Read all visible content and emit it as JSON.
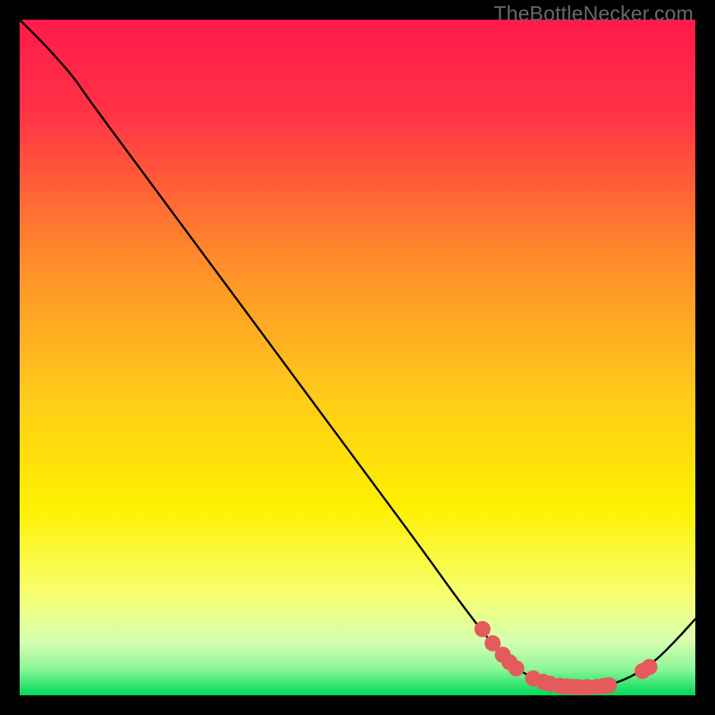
{
  "watermark": "TheBottleNecker.com",
  "chart_data": {
    "type": "line",
    "title": "",
    "xlabel": "",
    "ylabel": "",
    "xlim": [
      0,
      100
    ],
    "ylim": [
      0,
      100
    ],
    "grid": false,
    "legend": false,
    "background_gradient_top": "#ff1a4a",
    "background_gradient_mid_upper": "#ffb300",
    "background_gradient_mid_lower": "#fff700",
    "background_gradient_bottom": "#00e05a",
    "curve": [
      {
        "x": 0,
        "y": 100
      },
      {
        "x": 4,
        "y": 96
      },
      {
        "x": 8,
        "y": 91.5
      },
      {
        "x": 10,
        "y": 88.5
      },
      {
        "x": 20,
        "y": 75
      },
      {
        "x": 30,
        "y": 61.5
      },
      {
        "x": 40,
        "y": 48
      },
      {
        "x": 50,
        "y": 34.5
      },
      {
        "x": 60,
        "y": 21
      },
      {
        "x": 65,
        "y": 14
      },
      {
        "x": 70,
        "y": 7.5
      },
      {
        "x": 73,
        "y": 4.3
      },
      {
        "x": 76,
        "y": 2.5
      },
      {
        "x": 79,
        "y": 1.5
      },
      {
        "x": 82,
        "y": 1.2
      },
      {
        "x": 85,
        "y": 1.2
      },
      {
        "x": 88,
        "y": 1.7
      },
      {
        "x": 91,
        "y": 3.0
      },
      {
        "x": 94,
        "y": 5.0
      },
      {
        "x": 97,
        "y": 8.0
      },
      {
        "x": 100,
        "y": 11.3
      }
    ],
    "markers": [
      {
        "x": 68.5,
        "y": 9.8
      },
      {
        "x": 70.0,
        "y": 7.7
      },
      {
        "x": 71.5,
        "y": 6.0
      },
      {
        "x": 72.5,
        "y": 4.9
      },
      {
        "x": 73.5,
        "y": 4.0
      },
      {
        "x": 76.0,
        "y": 2.5
      },
      {
        "x": 77.5,
        "y": 2.0
      },
      {
        "x": 78.5,
        "y": 1.7
      },
      {
        "x": 80.0,
        "y": 1.4
      },
      {
        "x": 81.0,
        "y": 1.3
      },
      {
        "x": 81.8,
        "y": 1.25
      },
      {
        "x": 82.7,
        "y": 1.2
      },
      {
        "x": 84.0,
        "y": 1.2
      },
      {
        "x": 85.5,
        "y": 1.25
      },
      {
        "x": 86.5,
        "y": 1.4
      },
      {
        "x": 87.2,
        "y": 1.5
      },
      {
        "x": 92.2,
        "y": 3.6
      },
      {
        "x": 93.2,
        "y": 4.2
      }
    ],
    "marker_color": "#e55a5a",
    "marker_radius": 9,
    "curve_color": "#000000",
    "curve_width": 2.3
  }
}
